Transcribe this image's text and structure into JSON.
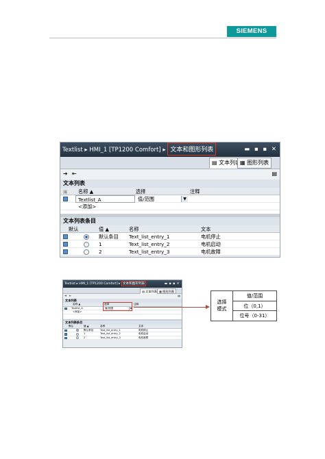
{
  "brand": {
    "logo_text": "SIEMENS",
    "color": "#0e9a9a"
  },
  "editor": {
    "title_path": "Textlist ▸ HMI_1 [TP1200 Comfort] ▸",
    "title_highlight": "文本和图形列表",
    "win_controls": "▬ ▪ ▪ ✕",
    "tab_text_list": "文本列表",
    "tab_graphic_list": "图形列表",
    "section_lists": "文本列表",
    "col_name": "名称 ▲",
    "col_select": "选择",
    "col_comment": "注释",
    "row_name": "Textlist_A",
    "row_select": "值/范围",
    "add_label": "<添加>",
    "section_entries": "文本列表条目",
    "col_default": "默认",
    "col_value": "值 ▲",
    "col_entry_name": "名称",
    "col_text": "文本",
    "entries": [
      {
        "value": "默认条目",
        "name": "Text_list_entry_1",
        "text": "电机停止",
        "default": true
      },
      {
        "value": "1",
        "name": "Text_list_entry_2",
        "text": "电机启动",
        "default": false
      },
      {
        "value": "2",
        "name": "Text_list_entry_3",
        "text": "电机故障",
        "default": false
      }
    ]
  },
  "mapping": {
    "label": "选择模式",
    "options": [
      "值/范围",
      "位（0,1）",
      "位号（0-31）"
    ]
  }
}
